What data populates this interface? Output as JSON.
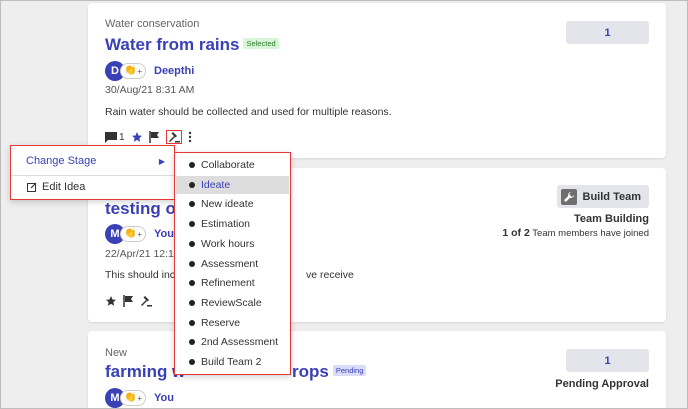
{
  "ideas": [
    {
      "category": "Water conservation",
      "title": "Water from rains",
      "badge": "Selected",
      "author_initial": "D",
      "author": "Deepthi",
      "date": "30/Aug/21 8:31 AM",
      "description": "Rain water should be collected and used for multiple reasons.",
      "comment_count": "1",
      "vote_count": "1"
    },
    {
      "title": "testing o",
      "author_initial": "M",
      "author": "You",
      "date": "22/Apr/21 12:11",
      "description_left": "This should inc",
      "description_right": "ve receive",
      "build_team_label": "Build Team",
      "team_name": "Team Building",
      "team_count": "1 of 2",
      "team_joined_text": "Team members have joined"
    },
    {
      "category": "New",
      "title_left": "farming w",
      "title_right": "rops",
      "badge": "Pending",
      "author_initial": "M",
      "author": "You",
      "vote_count": "1",
      "status": "Pending Approval"
    }
  ],
  "context_menu": {
    "change_stage": "Change Stage",
    "edit_idea": "Edit Idea"
  },
  "stages": [
    "Collaborate",
    "Ideate",
    "New ideate",
    "Estimation",
    "Work hours",
    "Assessment",
    "Refinement",
    "ReviewScale",
    "Reserve",
    "2nd Assessment",
    "Build Team 2"
  ],
  "active_stage": "Ideate",
  "icons": {
    "comment": "comment-icon",
    "star": "star-icon",
    "flag": "flag-icon",
    "gavel": "gavel-icon",
    "more": "more-vertical-icon",
    "wrench": "wrench-icon",
    "edit": "edit-icon",
    "chevron": "chevron-right-icon",
    "clap": "clap-icon"
  },
  "colors": {
    "accent": "#3a41b5",
    "highlight_border": "#e53935",
    "selected_badge": "#d7f5d7",
    "pending_badge": "#d9dcf6"
  }
}
